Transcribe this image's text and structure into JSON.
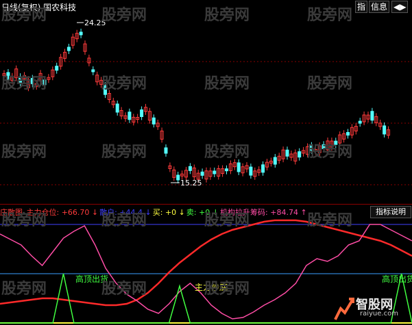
{
  "header": {
    "title": "日线(复权)  国农科技",
    "buttons": [
      "指",
      "信息"
    ],
    "arrows": "◀▶"
  },
  "price_chart": {
    "high_label": "24.25",
    "low_label": "15.25"
  },
  "indicator": {
    "name": "庄散图",
    "items": [
      {
        "label": "主力仓位:",
        "value": "+66.70",
        "arrow": "↓",
        "color": "#ff3b3b"
      },
      {
        "label": "散户:",
        "value": "+44.4",
        "arrow": "↓",
        "color": "#4040ff"
      },
      {
        "label": "买:",
        "value": "+0",
        "arrow": "↓",
        "color": "#ffff40"
      },
      {
        "label": "卖:",
        "value": "+0",
        "arrow": "↓",
        "color": "#40ff40"
      },
      {
        "label": "机构拉升筹码:",
        "value": "+84.74",
        "arrow": "↑",
        "color": "#ff4da6"
      }
    ],
    "help_button": "指标说明",
    "annotations": [
      "高顶出货",
      "主力抄底",
      "高顶出货"
    ]
  },
  "watermark": "股旁网",
  "logo": {
    "main": "智股网",
    "sub": "raiyue.com"
  },
  "colors": {
    "up": "#ff3b3b",
    "down": "#54ffff",
    "main_line": "#ff2a2a",
    "retail_line": "#ff4da6",
    "blue_line": "#4040ff"
  }
}
